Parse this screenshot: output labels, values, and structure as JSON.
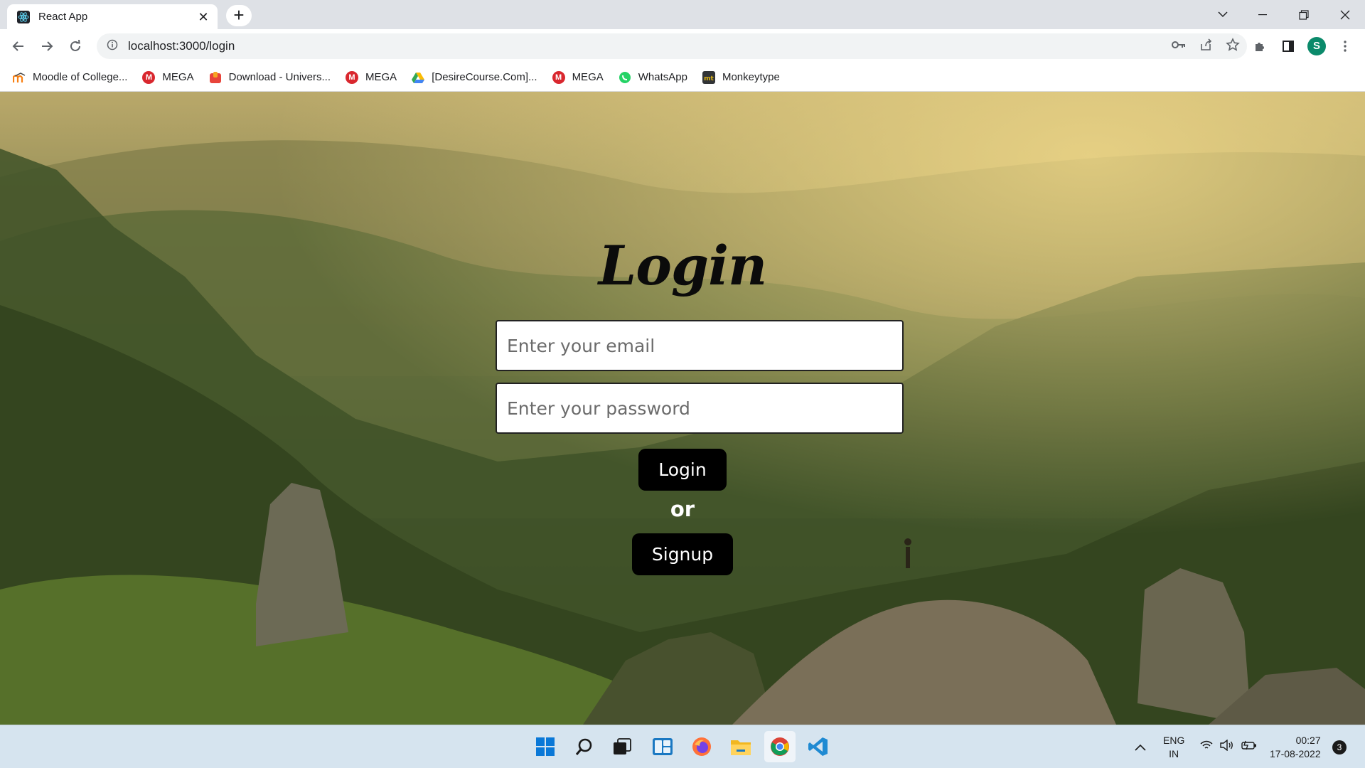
{
  "browser": {
    "tab_title": "React App",
    "url": "localhost:3000/login",
    "profile_initial": "S",
    "bookmarks": [
      {
        "label": "Moodle of College...",
        "icon": "moodle-icon"
      },
      {
        "label": "MEGA",
        "icon": "mega-icon"
      },
      {
        "label": "Download - Univers...",
        "icon": "download-icon"
      },
      {
        "label": "MEGA",
        "icon": "mega-icon"
      },
      {
        "label": "[DesireCourse.Com]...",
        "icon": "google-drive-icon"
      },
      {
        "label": "MEGA",
        "icon": "mega-icon"
      },
      {
        "label": "WhatsApp",
        "icon": "whatsapp-icon"
      },
      {
        "label": "Monkeytype",
        "icon": "monkeytype-icon"
      }
    ]
  },
  "page": {
    "title": "Login",
    "email_placeholder": "Enter your email",
    "password_placeholder": "Enter your password",
    "login_label": "Login",
    "or_label": "or",
    "signup_label": "Signup"
  },
  "taskbar": {
    "apps": [
      "windows-start-icon",
      "search-icon",
      "task-view-icon",
      "widgets-icon",
      "firefox-icon",
      "file-explorer-icon",
      "chrome-icon",
      "vscode-icon"
    ],
    "language_line1": "ENG",
    "language_line2": "IN",
    "time": "00:27",
    "date": "17-08-2022",
    "notification_count": "3"
  },
  "colors": {
    "button_bg": "#000000",
    "button_text": "#ffffff",
    "or_text": "#ffffff",
    "taskbar_bg": "#d6e4ef"
  }
}
